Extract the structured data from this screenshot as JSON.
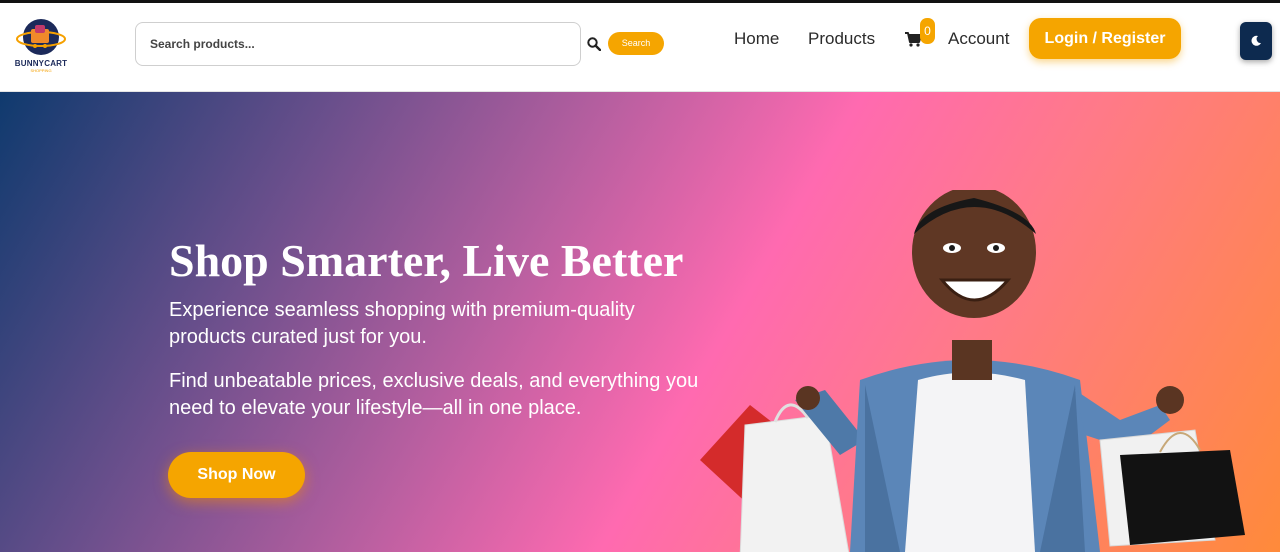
{
  "brand": {
    "name": "BUNNYCART",
    "tagline": "SHOPPING"
  },
  "search": {
    "placeholder": "Search products...",
    "button_label": "Search"
  },
  "nav": {
    "home": "Home",
    "products": "Products",
    "cart_count": "0",
    "account": "Account",
    "login_label": "Login / Register"
  },
  "theme_toggle": {
    "icon": "moon-icon"
  },
  "hero": {
    "title": "Shop Smarter, Live Better",
    "paragraph1": "Experience seamless shopping with premium-quality products curated just for you.",
    "paragraph2": "Find unbeatable prices, exclusive deals, and everything you need to elevate your lifestyle—all in one place.",
    "cta_label": "Shop Now"
  },
  "colors": {
    "accent": "#f5a500",
    "nav_text": "#2b2b2b",
    "toggle_bg": "#0d2a4f",
    "gradient": [
      "#0f3a6e",
      "#6a4f8c",
      "#b85fa0",
      "#ff6ab0",
      "#ff7a88",
      "#ff8a3a"
    ]
  }
}
